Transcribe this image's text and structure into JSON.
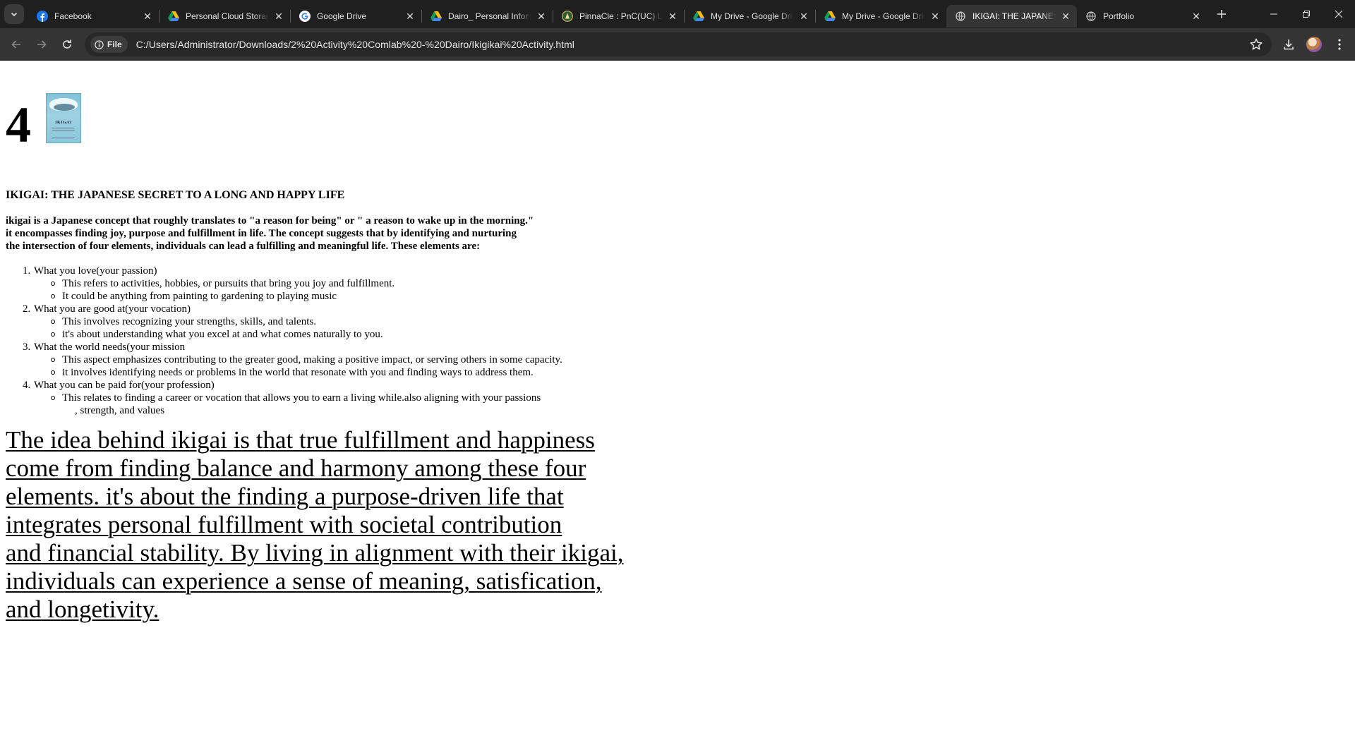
{
  "browser": {
    "tabs": [
      {
        "title": "Facebook",
        "icon": "facebook-icon",
        "active": false
      },
      {
        "title": "Personal Cloud Storage",
        "icon": "google-drive-icon",
        "active": false
      },
      {
        "title": "Google Drive",
        "icon": "google-icon",
        "active": false
      },
      {
        "title": "Dairo_ Personal Information",
        "icon": "google-drive-icon",
        "active": false
      },
      {
        "title": "PinnaCle : PnC(UC) Learning",
        "icon": "pinnacle-icon",
        "active": false
      },
      {
        "title": "My Drive - Google Drive",
        "icon": "google-drive-icon",
        "active": false
      },
      {
        "title": "My Drive - Google Drive",
        "icon": "google-drive-icon",
        "active": false
      },
      {
        "title": "IKIGAI: THE JAPANESE SECRET",
        "icon": "globe-icon",
        "active": true
      },
      {
        "title": "Portfolio",
        "icon": "globe-icon",
        "active": false
      }
    ],
    "chip_label": "File",
    "url": "C:/Users/Administrator/Downloads/2%20Activity%20Comlab%20-%20Dairo/Ikigikai%20Activity.html"
  },
  "page": {
    "number": "4",
    "book_cover_text": "IKIGAI",
    "title": "IKIGAI: THE JAPANESE SECRET TO A LONG AND HAPPY LIFE",
    "intro_lines": [
      "ikigai is a Japanese concept that roughly translates to \"a reason for being\" or \" a reason to wake up in the morning.\"",
      "it encompasses finding joy, purpose and fulfillment in life. The concept suggests that by identifying and nurturing",
      "the intersection of four elements, individuals can lead a fulfilling and meaningful life. These elements are:"
    ],
    "elements": [
      {
        "number": "1.",
        "label": "What you love(your passion)",
        "points": [
          "This refers to activities, hobbies, or pursuits that bring you joy and fulfillment.",
          "It could be anything from painting to gardening to playing music"
        ]
      },
      {
        "number": "2.",
        "label": "What you are good at(your vocation)",
        "points": [
          "This involves recognizing your strengths, skills, and talents.",
          "it's about understanding what you excel at and what comes naturally to you."
        ]
      },
      {
        "number": "3.",
        "label": "What the world needs(your mission",
        "points": [
          "This aspect emphasizes contributing to the greater good, making a positive impact, or serving others in some capacity.",
          "it involves identifying needs or problems in the world that resonate with you and finding ways to address them."
        ]
      },
      {
        "number": "4.",
        "label": "What you can be paid for(your profession)",
        "points": [
          "This relates to finding a career or vocation that allows you to earn a living while.also aligning with your passions"
        ],
        "continuation": ", strength, and values"
      }
    ],
    "closing_lines": [
      "The idea behind ikigai is that true fulfillment and happiness",
      "come from finding balance and harmony among these four",
      "elements. it's about the finding a purpose-driven life that",
      "integrates personal fulfillment with societal contribution",
      "and financial stability. By living in alignment with their ikigai,",
      "individuals can experience a sense of meaning, satisfication,",
      "and longetivity."
    ]
  },
  "colors": {
    "tabstrip_bg": "#1f1f1f",
    "toolbar_bg": "#353535",
    "omnibox_bg": "#282828",
    "page_bg": "#ffffff",
    "facebook_blue": "#1877f2"
  }
}
